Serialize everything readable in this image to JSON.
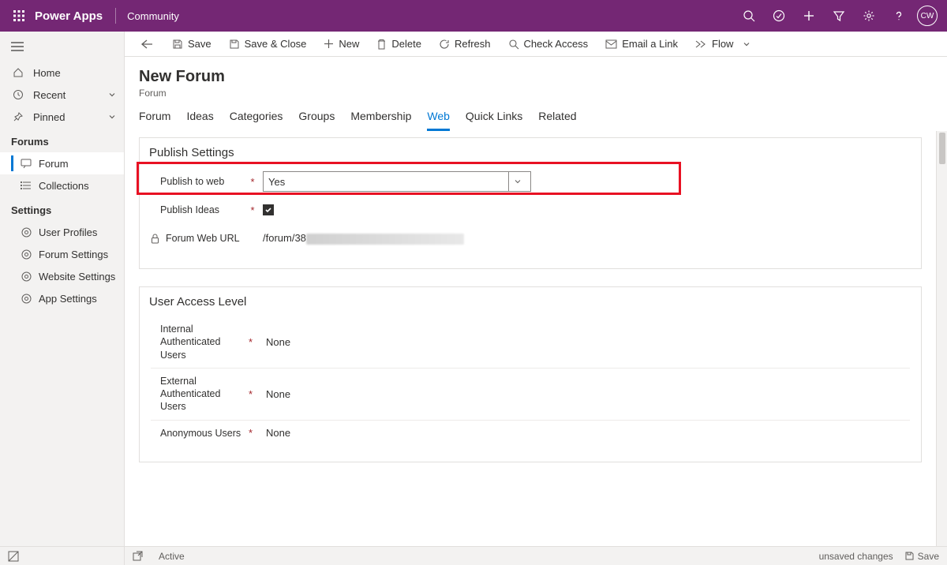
{
  "topbar": {
    "brand": "Power Apps",
    "context": "Community",
    "avatar": "CW"
  },
  "nav": {
    "home": "Home",
    "recent": "Recent",
    "pinned": "Pinned",
    "group_forums": "Forums",
    "forum": "Forum",
    "collections": "Collections",
    "group_settings": "Settings",
    "user_profiles": "User Profiles",
    "forum_settings": "Forum Settings",
    "website_settings": "Website Settings",
    "app_settings": "App Settings"
  },
  "cmd": {
    "save": "Save",
    "save_close": "Save & Close",
    "new": "New",
    "delete": "Delete",
    "refresh": "Refresh",
    "check_access": "Check Access",
    "email_link": "Email a Link",
    "flow": "Flow"
  },
  "page": {
    "title": "New Forum",
    "subtitle": "Forum"
  },
  "tabs": {
    "forum": "Forum",
    "ideas": "Ideas",
    "categories": "Categories",
    "groups": "Groups",
    "membership": "Membership",
    "web": "Web",
    "quick_links": "Quick Links",
    "related": "Related"
  },
  "publish": {
    "section": "Publish Settings",
    "to_web_label": "Publish to web",
    "to_web_value": "Yes",
    "ideas_label": "Publish Ideas",
    "url_label": "Forum Web URL",
    "url_prefix": "/forum/38"
  },
  "access": {
    "section": "User Access Level",
    "internal_label": "Internal Authenticated Users",
    "internal_value": "None",
    "external_label": "External Authenticated Users",
    "external_value": "None",
    "anon_label": "Anonymous Users",
    "anon_value": "None"
  },
  "status": {
    "state": "Active",
    "unsaved": "unsaved changes",
    "save": "Save"
  }
}
